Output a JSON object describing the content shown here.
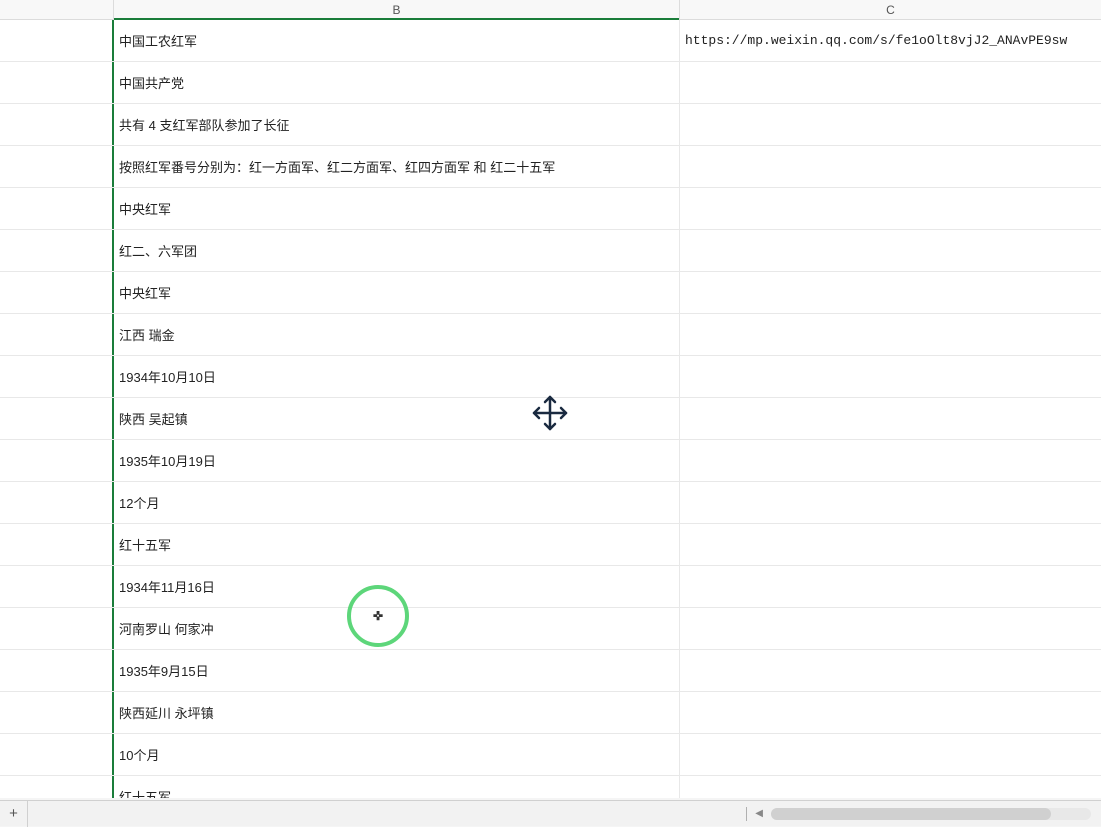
{
  "columns": {
    "b_label": "B",
    "c_label": "C"
  },
  "rows": [
    {
      "b": "中国工农红军",
      "c": "https://mp.weixin.qq.com/s/fe1oOlt8vjJ2_ANAvPE9sw"
    },
    {
      "b": "中国共产党",
      "c": ""
    },
    {
      "b": "共有 4 支红军部队参加了长征",
      "c": ""
    },
    {
      "b": "按照红军番号分别为：红一方面军、红二方面军、红四方面军 和 红二十五军",
      "c": ""
    },
    {
      "b": "中央红军",
      "c": ""
    },
    {
      "b": "红二、六军团",
      "c": ""
    },
    {
      "b": "中央红军",
      "c": ""
    },
    {
      "b": "江西 瑞金",
      "c": ""
    },
    {
      "b": "1934年10月10日",
      "c": ""
    },
    {
      "b": "陕西 吴起镇",
      "c": ""
    },
    {
      "b": "1935年10月19日",
      "c": ""
    },
    {
      "b": "12个月",
      "c": ""
    },
    {
      "b": "红十五军",
      "c": ""
    },
    {
      "b": "1934年11月16日",
      "c": ""
    },
    {
      "b": "河南罗山 何家冲",
      "c": ""
    },
    {
      "b": "1935年9月15日",
      "c": ""
    },
    {
      "b": "陕西延川 永坪镇",
      "c": ""
    },
    {
      "b": "10个月",
      "c": ""
    },
    {
      "b": "红十五军",
      "c": ""
    }
  ],
  "bottom": {
    "add_label": "+"
  }
}
